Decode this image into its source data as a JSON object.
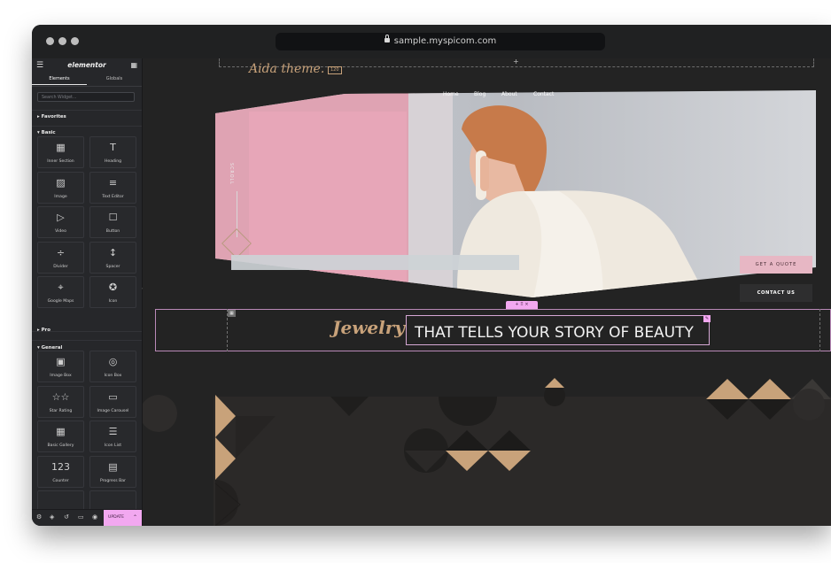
{
  "browser": {
    "url": "sample.myspicom.com"
  },
  "panel": {
    "brand": "elementor",
    "tabs": [
      "Elements",
      "Globals"
    ],
    "search_placeholder": "Search Widget...",
    "sections": {
      "favorites": "Favorites",
      "basic": "Basic",
      "pro": "Pro",
      "general": "General"
    },
    "basic_widgets": [
      {
        "label": "Inner Section",
        "icon": "inner-section-icon",
        "glyph": "▦"
      },
      {
        "label": "Heading",
        "icon": "heading-icon",
        "glyph": "T"
      },
      {
        "label": "Image",
        "icon": "image-icon",
        "glyph": "▨"
      },
      {
        "label": "Text Editor",
        "icon": "text-editor-icon",
        "glyph": "≡"
      },
      {
        "label": "Video",
        "icon": "video-icon",
        "glyph": "▷"
      },
      {
        "label": "Button",
        "icon": "button-icon",
        "glyph": "☐"
      },
      {
        "label": "Divider",
        "icon": "divider-icon",
        "glyph": "÷"
      },
      {
        "label": "Spacer",
        "icon": "spacer-icon",
        "glyph": "↕"
      },
      {
        "label": "Google Maps",
        "icon": "google-maps-icon",
        "glyph": "⌖"
      },
      {
        "label": "Icon",
        "icon": "star-icon",
        "glyph": "✪"
      }
    ],
    "general_widgets": [
      {
        "label": "Image Box",
        "icon": "image-box-icon",
        "glyph": "▣"
      },
      {
        "label": "Icon Box",
        "icon": "icon-box-icon",
        "glyph": "◎"
      },
      {
        "label": "Star Rating",
        "icon": "star-rating-icon",
        "glyph": "☆☆"
      },
      {
        "label": "Image Carousel",
        "icon": "image-carousel-icon",
        "glyph": "▭"
      },
      {
        "label": "Basic Gallery",
        "icon": "basic-gallery-icon",
        "glyph": "▦"
      },
      {
        "label": "Icon List",
        "icon": "icon-list-icon",
        "glyph": "☰"
      },
      {
        "label": "Counter",
        "icon": "counter-icon",
        "glyph": "123"
      },
      {
        "label": "Progress Bar",
        "icon": "progress-bar-icon",
        "glyph": "▤"
      }
    ],
    "footer": {
      "update_label": "UPDATE"
    }
  },
  "site": {
    "logo": "Aida theme.",
    "logo_badge": "120",
    "nav": [
      "Home",
      "Blog",
      "About",
      "Contact"
    ],
    "scroll_label": "SCROLL",
    "buttons": {
      "quote": "GET A QUOTE",
      "contact": "CONTACT US"
    },
    "headline_script": "Jewelry",
    "headline_text": "THAT TELLS YOUR STORY OF BEAUTY",
    "section_handle": "+ ⠿ ×"
  },
  "colors": {
    "accent_pink": "#f2a8f0",
    "gold": "#c8a27a",
    "button_pink": "#e7b7c4"
  }
}
